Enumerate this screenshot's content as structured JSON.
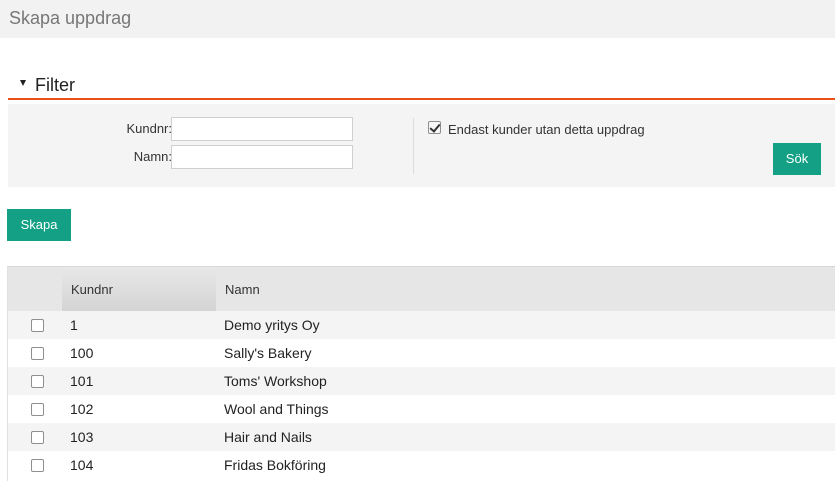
{
  "page": {
    "title": "Skapa uppdrag"
  },
  "filter": {
    "header": "Filter",
    "kundnr_label": "Kundnr:",
    "kundnr_value": "",
    "namn_label": "Namn:",
    "namn_value": "",
    "only_without_label": "Endast kunder utan detta uppdrag",
    "only_without_checked": true,
    "search_button": "Sök"
  },
  "actions": {
    "create_button": "Skapa"
  },
  "table": {
    "columns": [
      "Kundnr",
      "Namn"
    ],
    "rows": [
      {
        "kundnr": "1",
        "namn": "Demo yritys Oy",
        "checked": false
      },
      {
        "kundnr": "100",
        "namn": "Sally's Bakery",
        "checked": false
      },
      {
        "kundnr": "101",
        "namn": "Toms' Workshop",
        "checked": false
      },
      {
        "kundnr": "102",
        "namn": "Wool and Things",
        "checked": false
      },
      {
        "kundnr": "103",
        "namn": "Hair and Nails",
        "checked": false
      },
      {
        "kundnr": "104",
        "namn": "Fridas Bokföring",
        "checked": false
      }
    ]
  },
  "colors": {
    "accent": "#e8501c",
    "button": "#13a085"
  }
}
